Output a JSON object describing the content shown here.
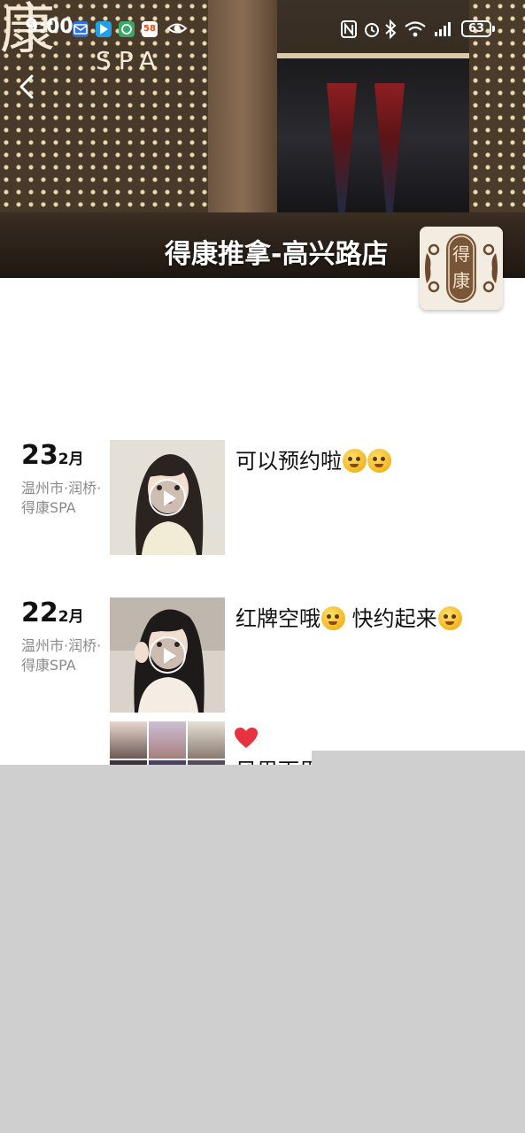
{
  "status_bar": {
    "time": "9:00",
    "battery": "63",
    "app_icons": [
      "mail-icon",
      "play-store-icon",
      "app-icon",
      "58-icon",
      "eye-icon"
    ],
    "app_58_label": "58"
  },
  "cover": {
    "sign_text": "康",
    "sign_sub": "SPA"
  },
  "profile": {
    "name": "得康推拿-高兴路店",
    "avatar_text": "得康"
  },
  "posts": [
    {
      "day": "23",
      "month": "2月",
      "location": "温州市·润桥·得康SPA",
      "type": "video",
      "text": "可以预约啦",
      "emojis": 2
    },
    {
      "day": "22",
      "month": "2月",
      "location": "温州市·润桥·得康SPA",
      "type": "video",
      "text_part1": "红牌空哦",
      "text_part2": " 快约起来",
      "emojis": 2
    }
  ],
  "post3": {
    "text": "风里雨里"
  },
  "colors": {
    "overlay": "#cfcfcf",
    "heart": "#e8323f"
  }
}
